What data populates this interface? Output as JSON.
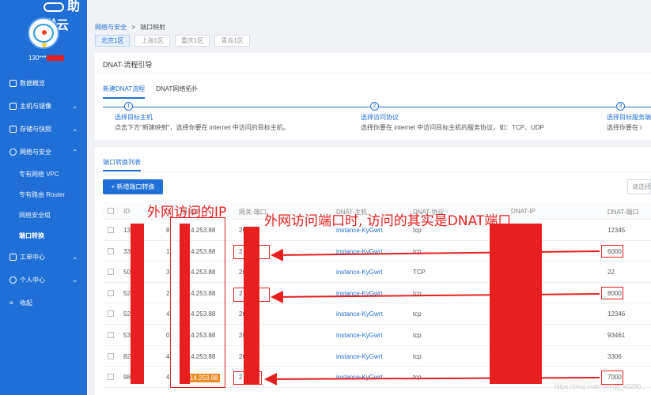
{
  "brand": {
    "name": "助学云"
  },
  "user": {
    "name": "130***"
  },
  "sidebar": {
    "items": [
      {
        "label": "数据概览",
        "icon": "monitor-icon"
      },
      {
        "label": "主机与镜像",
        "icon": "server-icon",
        "expandable": true
      },
      {
        "label": "存储与快照",
        "icon": "storage-icon",
        "expandable": true
      },
      {
        "label": "网络与安全",
        "icon": "globe-icon",
        "expanded": true
      }
    ],
    "sub_items": [
      {
        "label": "专有网络 VPC"
      },
      {
        "label": "专有路由 Router"
      },
      {
        "label": "网络安全组"
      },
      {
        "label": "端口转换",
        "active": true
      }
    ],
    "items2": [
      {
        "label": "工单中心",
        "icon": "ticket-icon",
        "expandable": true
      },
      {
        "label": "个人中心",
        "icon": "person-icon",
        "expandable": true
      },
      {
        "label": "收起",
        "icon": "collapse-icon"
      }
    ]
  },
  "breadcrumb": {
    "parent": "网络与安全",
    "separator": ">",
    "current": "端口映射"
  },
  "regions": [
    "北京1区",
    "上海1区",
    "重庆1区",
    "青岛1区"
  ],
  "guide": {
    "title": "DNAT-流程引导",
    "tabs": [
      "新建DNAT流程",
      "DNAT网络拓扑"
    ],
    "steps": [
      {
        "num": "1",
        "title": "选择目标主机",
        "desc": "点击下方\"新建映射\"，选择你要在 internet 中访问的目标主机。"
      },
      {
        "num": "2",
        "title": "选择访问协议",
        "desc": "选择你要在 internet 中访问目标主机的服务协议，如：TCP、UDP"
      },
      {
        "num": "3",
        "title": "选择目标服务端",
        "desc": "选择你要在 i"
      }
    ]
  },
  "list": {
    "title": "端口转换列表",
    "add_button": "+ 新增端口转换",
    "search_placeholder": "请选择",
    "headers": [
      "ID",
      "外网IP",
      "网关-端口",
      "DNAT-主机",
      "DNAT-协议",
      "DNAT-IP",
      "DNAT-端口"
    ],
    "rows": [
      {
        "id": "136",
        "id_tail": "8",
        "ip": "2.14.253.88",
        "gw": "26",
        "host": "instance-KyGwrt",
        "proto": "tcp",
        "port": "12345"
      },
      {
        "id": "339",
        "id_tail": "1",
        "ip": "2.14.253.88",
        "gw": "2",
        "host": "instance-KyGwrt",
        "proto": "tcp",
        "port": "6000"
      },
      {
        "id": "502",
        "id_tail": "3",
        "ip": "2.14.253.88",
        "gw": "26",
        "host": "instance-KyGwrt",
        "proto": "TCP",
        "port": "22"
      },
      {
        "id": "522",
        "id_tail": "2",
        "ip": "2.14.253.88",
        "gw": "2",
        "host": "instance-KyGwrt",
        "proto": "tcp",
        "port": "8000"
      },
      {
        "id": "528",
        "id_tail": "4",
        "ip": "2.14.253.88",
        "gw": "26",
        "host": "instance-KyGwrt",
        "proto": "tcp",
        "port": "12346"
      },
      {
        "id": "538",
        "id_tail": "0",
        "ip": "2.14.253.88",
        "gw": "26",
        "host": "instance-KyGwrt",
        "proto": "tcp",
        "port": "93461"
      },
      {
        "id": "827",
        "id_tail": "4",
        "ip": "2.14.253.88",
        "gw": "26",
        "host": "instance-KyGwrt",
        "proto": "tcp",
        "port": "3306"
      },
      {
        "id": "981",
        "id_tail": "4",
        "ip": "14.253.88",
        "gw": "2",
        "host": "instance-KyGwrt",
        "proto": "tcp",
        "port": "7000"
      }
    ]
  },
  "annotations": {
    "ip_note": "外网访问的IP",
    "port_note": "外网访问端口时, 访问的其实是DNAT端口"
  },
  "watermark": "https://blog.csdn.net/qq_43290..."
}
